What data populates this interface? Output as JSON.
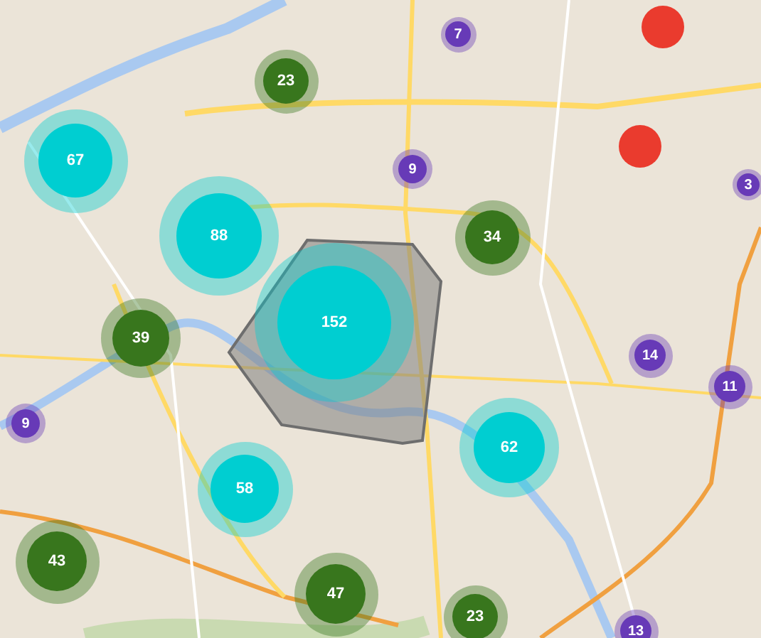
{
  "markers": [
    {
      "kind": "cluster_large",
      "count": "67"
    },
    {
      "kind": "cluster_large",
      "count": "88"
    },
    {
      "kind": "cluster_large",
      "count": "152"
    },
    {
      "kind": "cluster_large",
      "count": "58"
    },
    {
      "kind": "cluster_large",
      "count": "62"
    },
    {
      "kind": "cluster_medium",
      "count": "23"
    },
    {
      "kind": "cluster_medium",
      "count": "34"
    },
    {
      "kind": "cluster_medium",
      "count": "39"
    },
    {
      "kind": "cluster_medium",
      "count": "43"
    },
    {
      "kind": "cluster_medium",
      "count": "47"
    },
    {
      "kind": "cluster_medium",
      "count": "23"
    },
    {
      "kind": "cluster_small",
      "count": "7"
    },
    {
      "kind": "cluster_small",
      "count": "9"
    },
    {
      "kind": "cluster_small",
      "count": "3"
    },
    {
      "kind": "cluster_small",
      "count": "9"
    },
    {
      "kind": "cluster_small",
      "count": "14"
    },
    {
      "kind": "cluster_small",
      "count": "11"
    },
    {
      "kind": "cluster_small",
      "count": "13"
    },
    {
      "kind": "point"
    },
    {
      "kind": "point"
    }
  ]
}
